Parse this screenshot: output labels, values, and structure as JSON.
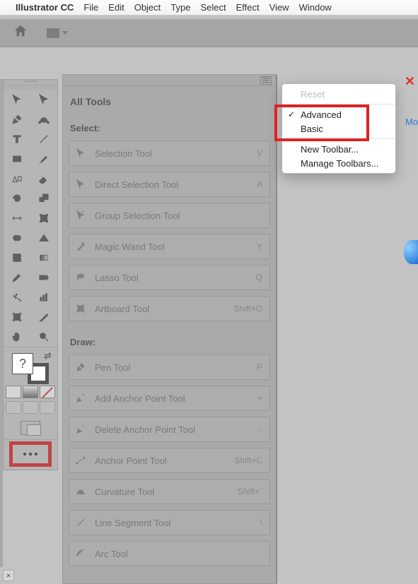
{
  "menubar": {
    "app": "Illustrator CC",
    "items": [
      "File",
      "Edit",
      "Object",
      "Type",
      "Select",
      "Effect",
      "View",
      "Window"
    ]
  },
  "alltools": {
    "title": "All Tools",
    "section_select": "Select:",
    "section_draw": "Draw:",
    "select_tools": [
      {
        "name": "Selection Tool",
        "shortcut": "V"
      },
      {
        "name": "Direct Selection Tool",
        "shortcut": "A"
      },
      {
        "name": "Group Selection Tool",
        "shortcut": ""
      },
      {
        "name": "Magic Wand Tool",
        "shortcut": "Y"
      },
      {
        "name": "Lasso Tool",
        "shortcut": "Q"
      },
      {
        "name": "Artboard Tool",
        "shortcut": "Shift+O"
      }
    ],
    "draw_tools": [
      {
        "name": "Pen Tool",
        "shortcut": "P"
      },
      {
        "name": "Add Anchor Point Tool",
        "shortcut": "+"
      },
      {
        "name": "Delete Anchor Point Tool",
        "shortcut": "-"
      },
      {
        "name": "Anchor Point Tool",
        "shortcut": "Shift+C"
      },
      {
        "name": "Curvature Tool",
        "shortcut": "Shift+`"
      },
      {
        "name": "Line Segment Tool",
        "shortcut": "\\"
      },
      {
        "name": "Arc Tool",
        "shortcut": ""
      }
    ]
  },
  "context_menu": {
    "reset": "Reset",
    "advanced": "Advanced",
    "basic": "Basic",
    "new_toolbar": "New Toolbar...",
    "manage": "Manage Toolbars..."
  },
  "fill_placeholder": "?",
  "right_link": "Mo"
}
